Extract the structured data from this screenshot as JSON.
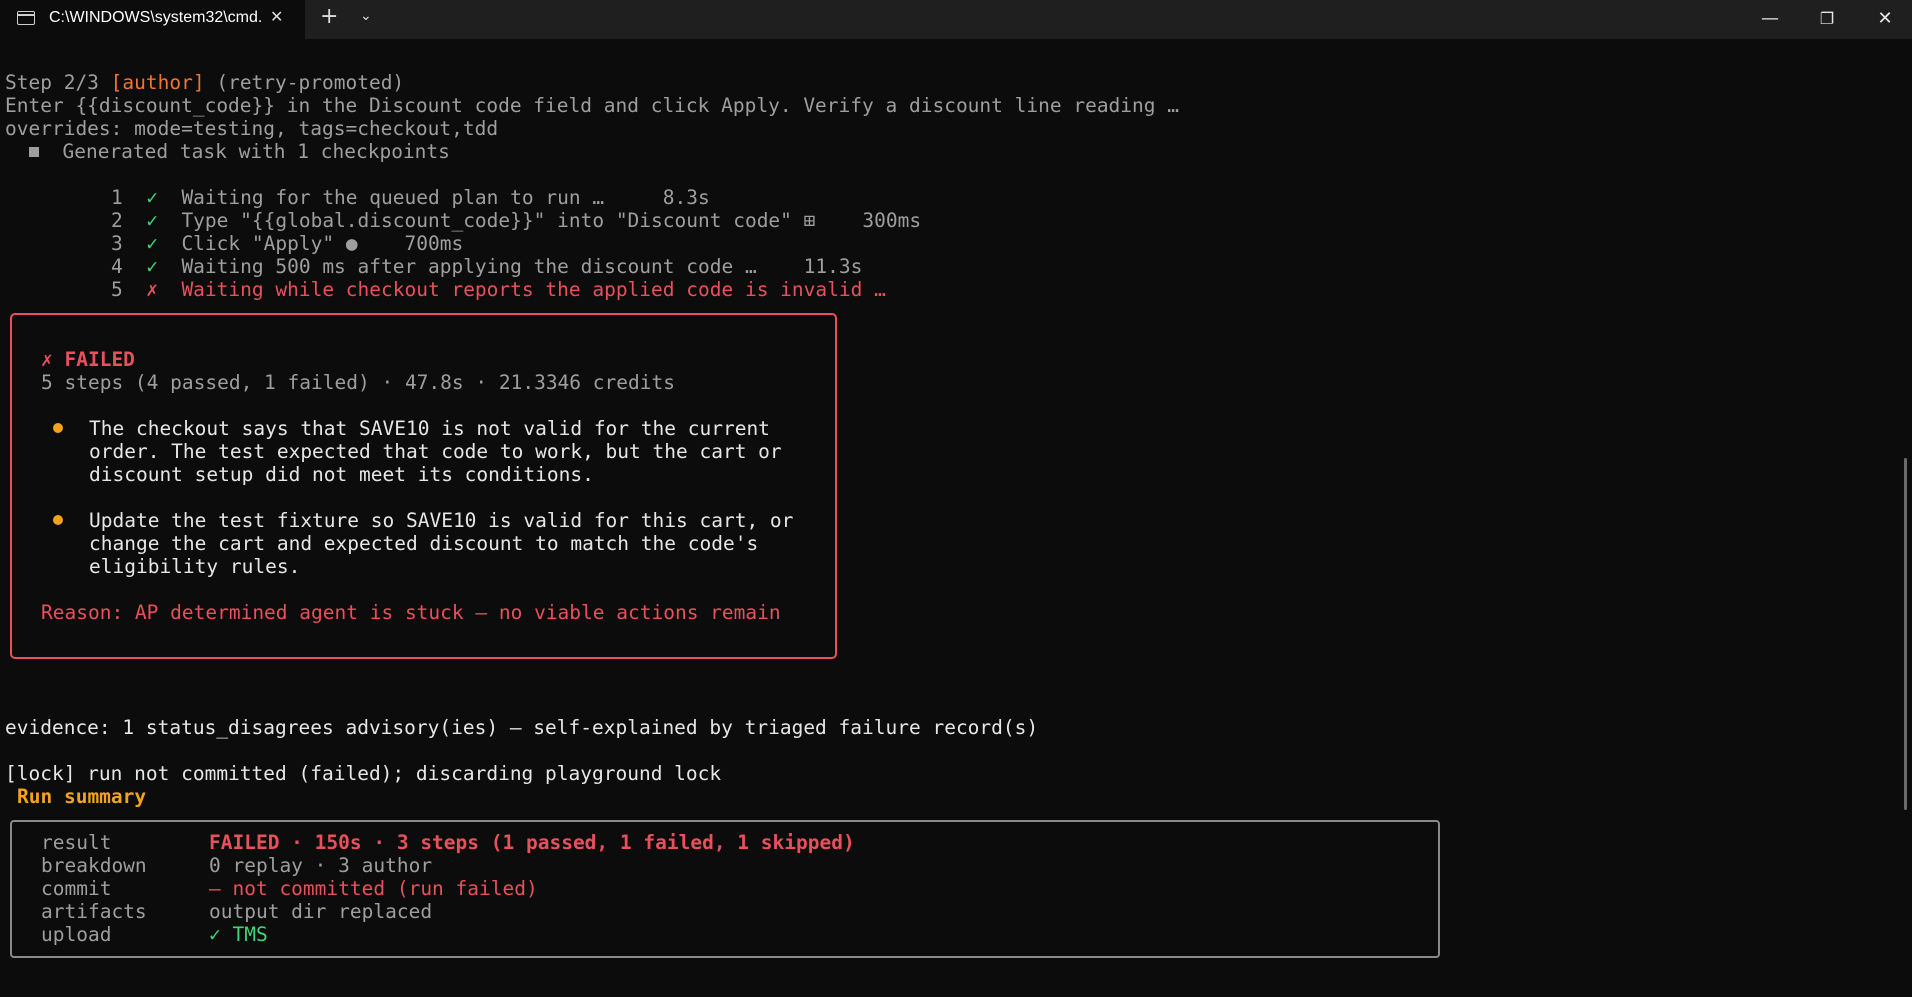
{
  "window": {
    "tab_title": "C:\\WINDOWS\\system32\\cmd.",
    "close_tab_glyph": "✕",
    "new_tab_glyph": "+",
    "dropdown_glyph": "⌄",
    "minimize_glyph": "—",
    "restore_glyph": "❐",
    "close_glyph": "✕"
  },
  "header": {
    "step_prefix": "Step 2/3 ",
    "role": "[author]",
    "status": " (retry-promoted)",
    "instruction": "Enter {{discount_code}} in the Discount code field and click Apply. Verify a discount line reading …",
    "overrides": "overrides: mode=testing, tags=checkout,tdd",
    "generated": "Generated task with 1 checkpoints"
  },
  "checkpoints": [
    {
      "num": "1",
      "mark": "✓",
      "text": "Waiting for the queued plan to run …",
      "glyph": "",
      "time": "8.3s",
      "state": "pass"
    },
    {
      "num": "2",
      "mark": "✓",
      "text": "Type \"{{global.discount_code}}\" into \"Discount code\"",
      "glyph": "⊞",
      "time": "300ms",
      "state": "pass"
    },
    {
      "num": "3",
      "mark": "✓",
      "text": "Click \"Apply\"",
      "glyph": "●",
      "time": "700ms",
      "state": "pass"
    },
    {
      "num": "4",
      "mark": "✓",
      "text": "Waiting 500 ms after applying the discount code …",
      "glyph": "",
      "time": "11.3s",
      "state": "pass"
    },
    {
      "num": "5",
      "mark": "✗",
      "text": "Waiting while checkout reports the applied code is invalid …",
      "glyph": "",
      "time": "",
      "state": "fail"
    }
  ],
  "failure": {
    "title": "✗ FAILED",
    "summary": "5 steps (4 passed, 1 failed) · 47.8s · 21.3346 credits",
    "bullets": [
      [
        "The checkout says that SAVE10 is not valid for the current",
        "order. The test expected that code to work, but the cart or",
        "discount setup did not meet its conditions."
      ],
      [
        "Update the test fixture so SAVE10 is valid for this cart, or",
        "change the cart and expected discount to match the code's",
        "eligibility rules."
      ]
    ],
    "reason": "Reason: AP determined agent is stuck — no viable actions remain"
  },
  "evidence": "evidence: 1 status_disagrees advisory(ies) — self-explained by triaged failure record(s)",
  "lock": "[lock] run not committed (failed); discarding playground lock",
  "run_summary": {
    "heading": "Run summary",
    "rows": [
      {
        "key": "result",
        "value": "FAILED · 150s · 3 steps (1 passed, 1 failed, 1 skipped)",
        "style": "fail"
      },
      {
        "key": "breakdown",
        "value": "0 replay · 3 author",
        "style": "plain"
      },
      {
        "key": "commit",
        "value": "— not committed (run failed)",
        "style": "warn"
      },
      {
        "key": "artifacts",
        "value": "output dir replaced",
        "style": "plain"
      },
      {
        "key": "upload",
        "value": "✓ TMS",
        "style": "ok"
      }
    ]
  }
}
